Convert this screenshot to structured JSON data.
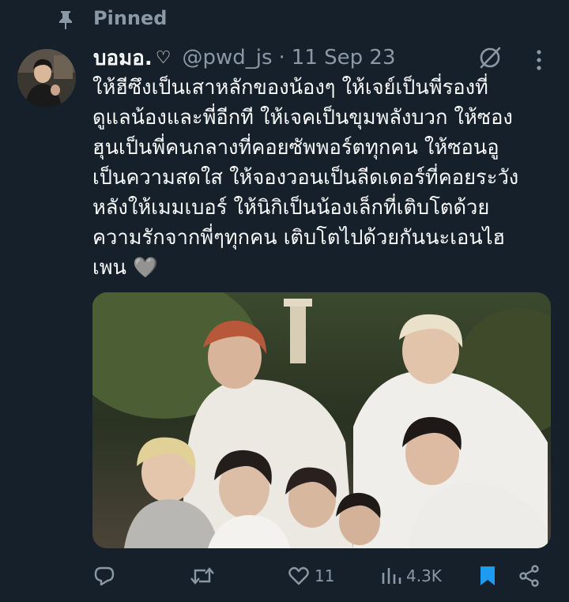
{
  "pinned": {
    "label": "Pinned"
  },
  "author": {
    "display_name": "บอมอ.",
    "emoji": "♡",
    "handle": "@pwd_js",
    "separator": "·",
    "date": "11 Sep 23"
  },
  "tweet": {
    "text": "ให้ฮีซึงเป็นเสาหลักของน้องๆ ให้เจย์เป็นพี่รองที่\nดูแลน้องและพี่อีกที ให้เจคเป็นขุมพลังบวก ให้ซอง\nฮุนเป็นพี่คนกลางที่คอยซัพพอร์ตทุกคน ให้ซอนอู\nเป็นความสดใส ให้จองวอนเป็นลีดเดอร์ที่คอยระวัง\nหลังให้เมมเบอร์ ให้นิกิเป็นน้องเล็กที่เติบโตด้วย\nความรักจากพี่ๆทุกคน เติบโตไปด้วยกันนะเอนไฮ\nเพน 🩶",
    "media_alt": "Group photo of seven members taking a selfie at night"
  },
  "actions": {
    "reply_count": "",
    "retweet_count": "",
    "like_count": "11",
    "views_count": "4.3K"
  },
  "colors": {
    "background": "#15202b",
    "text": "#f7f9f9",
    "secondary": "#8b98a5",
    "bookmark_active": "#1d9bf0"
  },
  "icons": [
    "pin-icon",
    "grok-icon",
    "more-icon",
    "reply-icon",
    "retweet-icon",
    "heart-icon",
    "views-icon",
    "bookmark-icon",
    "share-icon"
  ]
}
